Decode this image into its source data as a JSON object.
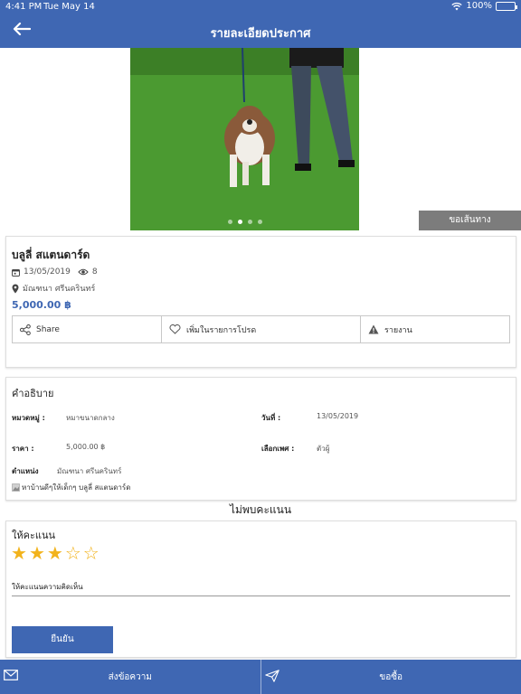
{
  "status_bar": {
    "time": "4:41 PM",
    "date": "Tue May 14",
    "battery": "100%"
  },
  "header": {
    "title": "รายละเอียดประกาศ"
  },
  "gallery": {
    "image_count": 4,
    "active_index": 1
  },
  "directions_label": "ขอเส้นทาง",
  "listing": {
    "name": "บลูลี่ สแตนดาร์ด",
    "date": "13/05/2019",
    "views": "8",
    "location": "มัณฑนา ศรีนครินทร์",
    "price": "5,000.00 ฿"
  },
  "actions": {
    "share": "Share",
    "favorite": "เพิ่มในรายการโปรด",
    "report": "รายงาน"
  },
  "description": {
    "title": "คำอธิบาย",
    "category_label": "หมวดหมู่ :",
    "category_value": "หมาขนาดกลาง",
    "date_label": "วันที่ :",
    "date_value": "13/05/2019",
    "price_label": "ราคา :",
    "price_value": "5,000.00 ฿",
    "gender_label": "เลือกเพศ :",
    "gender_value": "ตัวผู้",
    "location_label": "ตำแหน่ง",
    "location_value": "มัณฑนา ศรีนครินทร์",
    "text": "หาบ้านดีๆให้เด็กๆ บลูลี่ สแตนดาร์ด"
  },
  "no_rating": "ไม่พบคะแนน",
  "rating": {
    "title": "ให้คะแนน",
    "stars_value": 3,
    "stars_max": 5,
    "comment_label": "ให้คะแนนความคิดเห็น",
    "submit": "ยืนยัน"
  },
  "bottom_bar": {
    "message": "ส่งข้อความ",
    "buy": "ขอซื้อ"
  },
  "colors": {
    "primary": "#3f67b3",
    "star": "#f2b31c",
    "directions_bg": "#7c7c7c"
  }
}
